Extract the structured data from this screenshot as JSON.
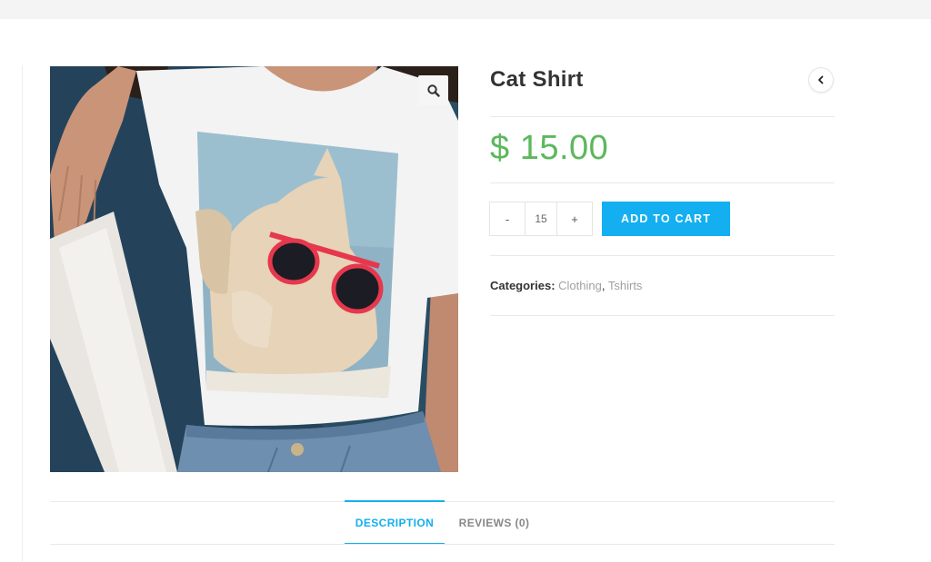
{
  "product": {
    "title": "Cat Shirt",
    "price": "$ 15.00",
    "quantity": "15",
    "qty_minus": "-",
    "qty_plus": "+",
    "add_to_cart": "ADD TO CART",
    "categories_label": "Categories:",
    "categories": [
      "Clothing",
      "Tshirts"
    ],
    "category_separator": ","
  },
  "tabs": [
    {
      "label": "DESCRIPTION",
      "active": true
    },
    {
      "label": "REVIEWS (0)",
      "active": false
    }
  ],
  "colors": {
    "accent": "#13aff0",
    "price": "#5cb85c"
  },
  "icons": {
    "zoom": "magnifier-icon",
    "prev": "chevron-left-icon"
  }
}
